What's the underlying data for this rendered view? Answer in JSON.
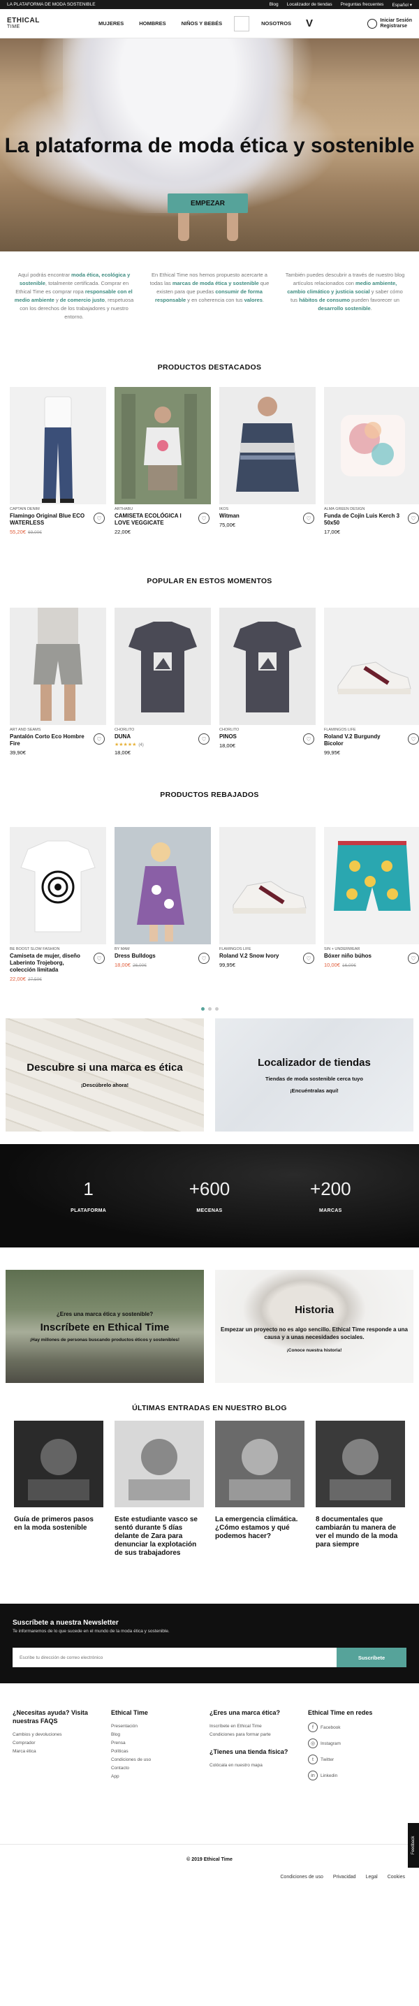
{
  "topbar": {
    "tagline": "LA PLATAFORMA DE MODA SOSTENIBLE",
    "links": [
      "Blog",
      "Localizador de tiendas",
      "Preguntas frecuentes"
    ],
    "language": "Español ▾"
  },
  "header": {
    "logo_line1": "ETHICAL",
    "logo_line2": "TIME",
    "nav": [
      "MUJERES",
      "HOMBRES",
      "NIÑOS Y BEBÉS",
      "NOSOTROS"
    ],
    "brand_mark": "V",
    "login_line1": "Iniciar Sesión",
    "login_line2": "Registrarse"
  },
  "hero": {
    "title": "La plataforma de moda ética y sostenible",
    "cta": "EMPEZAR"
  },
  "intro": [
    {
      "parts": [
        {
          "t": "Aquí podrás encontrar ",
          "b": false
        },
        {
          "t": "moda ética, ecológica y sostenible",
          "b": true
        },
        {
          "t": ", totalmente certificada. Comprar en Ethical Time es comprar ropa ",
          "b": false
        },
        {
          "t": "responsable con el medio ambiente",
          "b": true
        },
        {
          "t": " y ",
          "b": false
        },
        {
          "t": "de comercio justo",
          "b": true
        },
        {
          "t": ", respetuosa con los derechos de los trabajadores y nuestro entorno.",
          "b": false
        }
      ]
    },
    {
      "parts": [
        {
          "t": "En Ethical Time nos hemos propuesto acercarte a todas las ",
          "b": false
        },
        {
          "t": "marcas de moda ética y sostenible",
          "b": true
        },
        {
          "t": " que existen para que puedas ",
          "b": false
        },
        {
          "t": "consumir de forma responsable",
          "b": true
        },
        {
          "t": " y en coherencia con tus ",
          "b": false
        },
        {
          "t": "valores",
          "b": true
        },
        {
          "t": ".",
          "b": false
        }
      ]
    },
    {
      "parts": [
        {
          "t": "También puedes descubrir a través de nuestro blog artículos relacionados con ",
          "b": false
        },
        {
          "t": "medio ambiente, cambio climático y justicia social",
          "b": true
        },
        {
          "t": " y saber cómo tus ",
          "b": false
        },
        {
          "t": "hábitos de consumo",
          "b": true
        },
        {
          "t": " pueden favorecer un ",
          "b": false
        },
        {
          "t": "desarrollo sostenible",
          "b": true
        },
        {
          "t": ".",
          "b": false
        }
      ]
    }
  ],
  "sections": {
    "featured": "PRODUCTOS DESTACADOS",
    "popular": "POPULAR EN ESTOS MOMENTOS",
    "sale": "PRODUCTOS REBAJADOS",
    "blog": "ÚLTIMAS ENTRADAS EN NUESTRO BLOG"
  },
  "featured": [
    {
      "brand": "CAPTAIN DENIM",
      "name": "Flamingo Original Blue ECO WATERLESS",
      "price": "55,20€",
      "old": "69,00€",
      "icon": "jeans",
      "bg": "#f1f1f1",
      "fg": "#3b4f78"
    },
    {
      "brand": "ARTHABU",
      "name": "CAMISETA ECOLÓGICA I LOVE VEGGICATE",
      "price": "22,00€",
      "old": "",
      "icon": "tshirt-woman",
      "bg": "#8c9c7c",
      "fg": "#ececec"
    },
    {
      "brand": "IKOS",
      "name": "Witman",
      "price": "75,00€",
      "old": "",
      "icon": "sweater",
      "bg": "#ececec",
      "fg": "#3d4a62"
    },
    {
      "brand": "ALMA GREEN DESIGN",
      "name": "Funda de Cojín Luis Kerch 3 50x50",
      "price": "17,00€",
      "old": "",
      "icon": "cushion",
      "bg": "#efefef",
      "fg": "#e4a0a6"
    }
  ],
  "popular": [
    {
      "brand": "ART AND SEAMS",
      "name": "Pantalón Corto Eco Hombre Fire",
      "price": "39,90€",
      "old": "",
      "rating": "",
      "icon": "shorts",
      "bg": "#ededed",
      "fg": "#9a9a96"
    },
    {
      "brand": "CHORLITO",
      "name": "DUNA",
      "price": "18,00€",
      "old": "",
      "rating": "(4)",
      "icon": "tshirt-print",
      "bg": "#e9e9e9",
      "fg": "#4a4a55"
    },
    {
      "brand": "CHORLITO",
      "name": "PINOS",
      "price": "18,00€",
      "old": "",
      "rating": "",
      "icon": "tshirt-print",
      "bg": "#e9e9e9",
      "fg": "#4a4a55"
    },
    {
      "brand": "FLAMINGOS LIFE",
      "name": "Roland V.2 Burgundy Bicolor",
      "price": "99,95€",
      "old": "",
      "rating": "",
      "icon": "sneaker",
      "bg": "#f1f1f1",
      "fg": "#f3f1ee"
    }
  ],
  "sale": [
    {
      "brand": "BE BOOST SLOW FASHION",
      "name": "Camiseta de mujer, diseño Laberinto Trojeborg, colección limitada",
      "price": "22,00€",
      "old": "27,50€",
      "icon": "tshirt-white",
      "bg": "#efefef",
      "fg": "#ffffff"
    },
    {
      "brand": "BY MAM",
      "name": "Dress Bulldogs",
      "price": "18,00€",
      "old": "26,00€",
      "icon": "dress-kid",
      "bg": "#c9cfd6",
      "fg": "#8a5fa6"
    },
    {
      "brand": "FLAMINGOS LIFE",
      "name": "Roland V.2 Snow Ivory",
      "price": "99,95€",
      "old": "",
      "icon": "sneaker",
      "bg": "#efefef",
      "fg": "#f3f1ee"
    },
    {
      "brand": "SIN + UNDERWEAR",
      "name": "Bóxer niño búhos",
      "price": "10,00€",
      "old": "16,00€",
      "icon": "boxer",
      "bg": "#f2f2f2",
      "fg": "#2aa7b0"
    }
  ],
  "promos": [
    {
      "title": "Descubre si una marca es ética",
      "sub": "¡Descúbrelo ahora!"
    },
    {
      "title": "Localizador de tiendas",
      "sub1": "Tiendas de moda sostenible cerca tuyo",
      "sub2": "¡Encuéntralas aquí!"
    }
  ],
  "stats": [
    {
      "n": "1",
      "l": "PLATAFORMA"
    },
    {
      "n": "+600",
      "l": "MECENAS"
    },
    {
      "n": "+200",
      "l": "MARCAS"
    }
  ],
  "banners": {
    "left": {
      "q": "¿Eres una marca ética y sostenible?",
      "big": "Inscríbete en Ethical Time",
      "sm": "¡Hay millones de personas buscando productos éticos y sostenibles!"
    },
    "right": {
      "big": "Historia",
      "mid": "Empezar un proyecto no es algo sencillo. Ethical Time responde a una causa y a unas necesidades sociales.",
      "sm": "¡Conoce nuestra historia!"
    }
  },
  "blog": [
    {
      "title": "Guía de primeros pasos en la moda sostenible",
      "icon": "blog-photo-1"
    },
    {
      "title": "Este estudiante vasco se sentó durante 5 días delante de Zara para denunciar la explotación de sus trabajadores",
      "icon": "blog-photo-2"
    },
    {
      "title": "La emergencia climática. ¿Cómo estamos y qué podemos hacer?",
      "icon": "blog-photo-3"
    },
    {
      "title": "8 documentales que cambiarán tu manera de ver el mundo de la moda para siempre",
      "icon": "blog-photo-4"
    }
  ],
  "newsletter": {
    "title": "Suscríbete a nuestra Newsletter",
    "text": "Te informaremos de lo que sucede en el mundo de la moda ética y sostenible.",
    "placeholder": "Escribe tu dirección de correo electrónico",
    "button": "Suscríbete"
  },
  "footer": {
    "help_title": "¿Necesitas ayuda? Visita nuestras FAQS",
    "help_links": [
      "Cambios y devoluciones",
      "Comprador",
      "Marca ética"
    ],
    "et_title": "Ethical Time",
    "et_links": [
      "Presentación",
      "Blog",
      "Prensa",
      "Políticas",
      "Condiciones de uso",
      "Contacto",
      "App"
    ],
    "brand_title": "¿Eres una marca ética?",
    "brand_links": [
      "Inscríbete en Ethical Time",
      "Condiciones para formar parte"
    ],
    "shop_title": "¿Tienes una tienda física?",
    "shop_links": [
      "Colócala en nuestro mapa"
    ],
    "social_title": "Ethical Time en redes",
    "social": [
      {
        "label": "Facebook",
        "glyph": "f"
      },
      {
        "label": "Instagram",
        "glyph": "◎"
      },
      {
        "label": "Twitter",
        "glyph": "t"
      },
      {
        "label": "Linkedin",
        "glyph": "in"
      }
    ],
    "feedback": "Feedback",
    "copyright": "© 2019 Ethical Time",
    "bottom_links": [
      "Condiciones de uso",
      "Privacidad",
      "Legal",
      "Cookies"
    ]
  },
  "colors": {
    "accent": "#56a39a",
    "sale": "#e05c3a"
  }
}
